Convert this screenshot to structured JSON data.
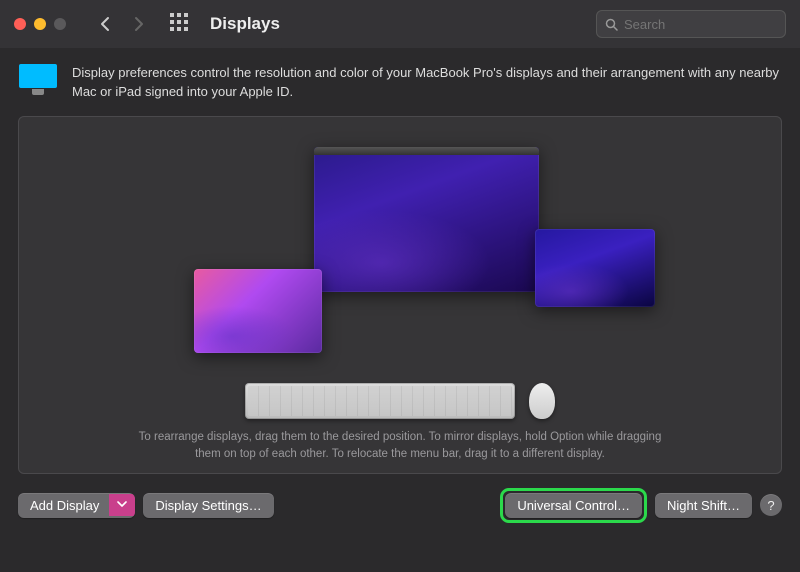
{
  "window": {
    "title": "Displays",
    "search_placeholder": "Search"
  },
  "intro": {
    "text": "Display preferences control the resolution and color of your MacBook Pro's displays and their arrangement with any nearby Mac or iPad signed into your Apple ID."
  },
  "hint": {
    "line1": "To rearrange displays, drag them to the desired position. To mirror displays, hold Option while dragging",
    "line2": "them on top of each other. To relocate the menu bar, drag it to a different display."
  },
  "footer": {
    "add_display": "Add Display",
    "display_settings": "Display Settings…",
    "universal_control": "Universal Control…",
    "night_shift": "Night Shift…",
    "help": "?"
  }
}
